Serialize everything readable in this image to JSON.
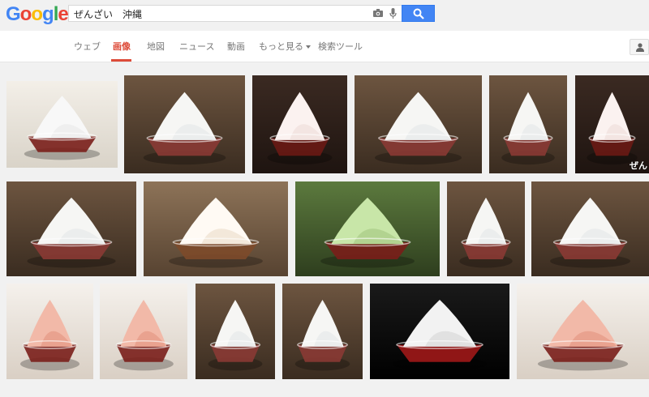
{
  "logo": {
    "letters": [
      "G",
      "o",
      "o",
      "g",
      "l",
      "e"
    ],
    "colors": [
      "#4285f4",
      "#ea4335",
      "#fbbc05",
      "#4285f4",
      "#34a853",
      "#ea4335"
    ]
  },
  "search": {
    "query": "ぜんざい　沖縄"
  },
  "tabs": [
    {
      "label": "ウェブ",
      "active": false
    },
    {
      "label": "画像",
      "active": true
    },
    {
      "label": "地図",
      "active": false
    },
    {
      "label": "ニュース",
      "active": false
    },
    {
      "label": "動画",
      "active": false
    },
    {
      "label": "もっと見る",
      "active": false
    },
    {
      "label": "検索ツール",
      "active": false
    }
  ],
  "colors": {
    "accent": "#dd4b39",
    "search_button": "#4285f4"
  },
  "images": [
    {
      "theme": "plate",
      "caption": ""
    },
    {
      "theme": "white",
      "caption": ""
    },
    {
      "theme": "dark",
      "caption": ""
    },
    {
      "theme": "white",
      "caption": ""
    },
    {
      "theme": "white",
      "caption": ""
    },
    {
      "theme": "dark",
      "caption": "ぜん"
    },
    {
      "theme": "white",
      "caption": ""
    },
    {
      "theme": "brown",
      "caption": ""
    },
    {
      "theme": "green",
      "caption": ""
    },
    {
      "theme": "white",
      "caption": ""
    },
    {
      "theme": "white",
      "caption": ""
    },
    {
      "theme": "pink",
      "caption": ""
    },
    {
      "theme": "pink",
      "caption": ""
    },
    {
      "theme": "white",
      "caption": ""
    },
    {
      "theme": "white",
      "caption": ""
    },
    {
      "theme": "darkred",
      "caption": ""
    },
    {
      "theme": "pink",
      "caption": ""
    }
  ]
}
